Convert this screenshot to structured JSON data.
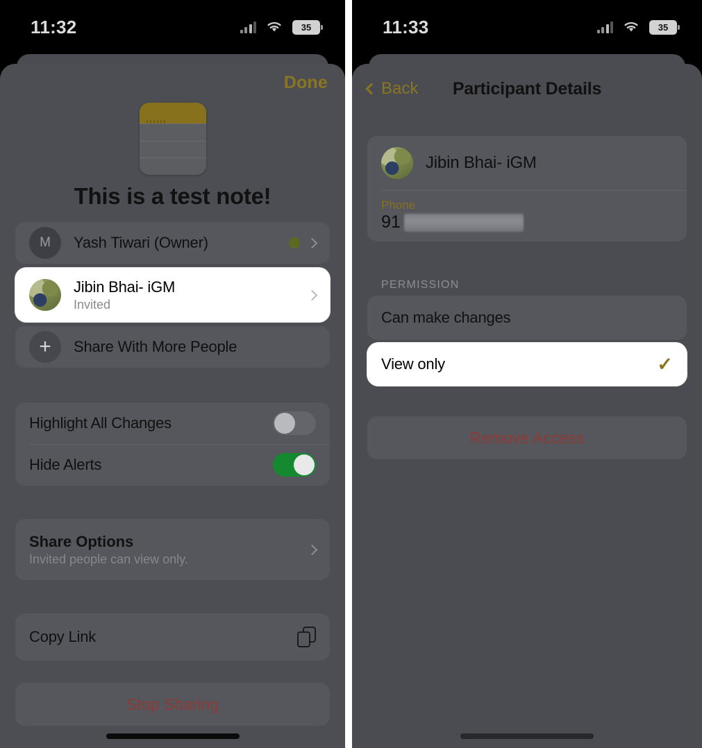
{
  "left": {
    "statusbar": {
      "time": "11:32",
      "battery": "35",
      "signal_icon": "cellular-bars-icon",
      "wifi_icon": "wifi-icon",
      "battery_icon": "battery-icon"
    },
    "done_label": "Done",
    "note": {
      "icon": "notes-app-icon",
      "title": "This is a test note!"
    },
    "participants": [
      {
        "name": "Yash Tiwari (Owner)",
        "sub": "",
        "avatar_initial": "M",
        "avatar_type": "initial",
        "status_dot": "#5a6b1f",
        "highlighted": false
      },
      {
        "name": "Jibin Bhai- iGM",
        "sub": "Invited",
        "avatar_initial": "",
        "avatar_type": "photo",
        "status_dot": "",
        "highlighted": true
      }
    ],
    "share_more_label": "Share With More People",
    "share_more_icon": "plus-icon",
    "toggles": [
      {
        "label": "Highlight All Changes",
        "on": false
      },
      {
        "label": "Hide Alerts",
        "on": true
      }
    ],
    "share_options": {
      "title": "Share Options",
      "subtitle": "Invited people can view only."
    },
    "copy_link": {
      "label": "Copy Link",
      "icon": "copy-duplicate-icon"
    },
    "stop_sharing_label": "Stop Sharing"
  },
  "right": {
    "statusbar": {
      "time": "11:33",
      "battery": "35",
      "signal_icon": "cellular-bars-icon",
      "wifi_icon": "wifi-icon",
      "battery_icon": "battery-icon"
    },
    "nav": {
      "back_label": "Back",
      "back_icon": "chevron-left-icon",
      "title": "Participant Details"
    },
    "person": {
      "name": "Jibin Bhai- iGM",
      "avatar_type": "photo"
    },
    "phone": {
      "label": "Phone",
      "value_prefix": "91",
      "value_redacted": true
    },
    "permission": {
      "section_label": "PERMISSION",
      "options": [
        {
          "label": "Can make changes",
          "selected": false,
          "highlighted": false
        },
        {
          "label": "View only",
          "selected": true,
          "highlighted": true,
          "check_icon": "checkmark-icon"
        }
      ]
    },
    "remove_access_label": "Remove Access"
  },
  "colors": {
    "accent_gold": "#8a7521",
    "danger_red": "#8e3a36",
    "toggle_on_green": "#15892f",
    "status_dot_green": "#5a6b1f",
    "sheet_bg": "#4c4e53",
    "card_bg": "#55575c",
    "highlight_white": "#ffffff"
  }
}
